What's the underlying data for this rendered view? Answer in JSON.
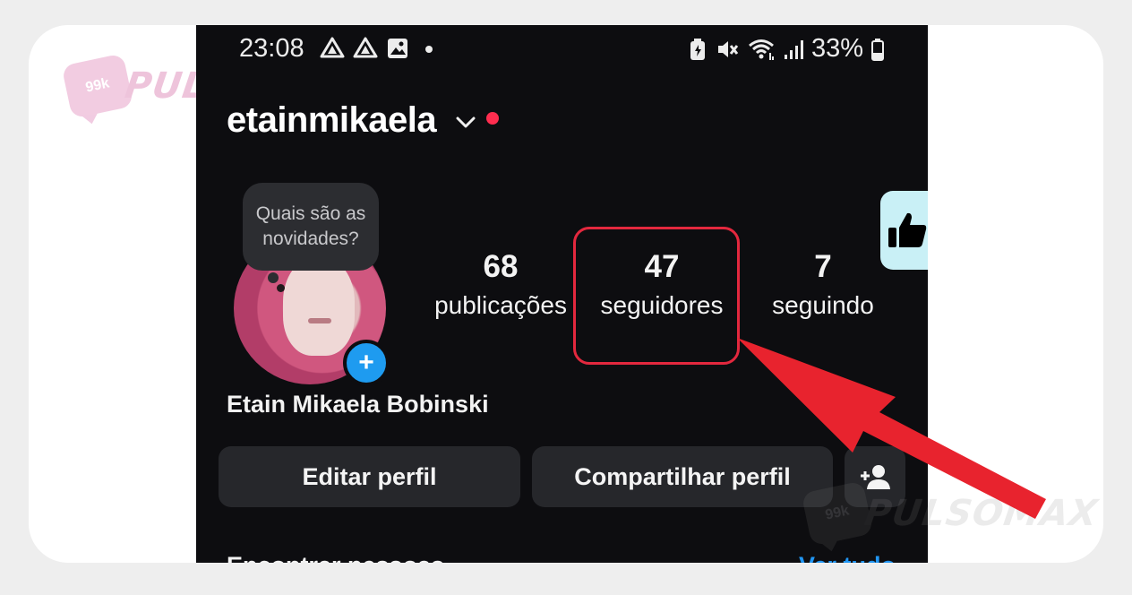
{
  "watermark": {
    "brand": "PULSOMAX",
    "badge": "99k"
  },
  "status_bar": {
    "time": "23:08",
    "left_icons": [
      "drive-icon",
      "drive-icon",
      "image-icon",
      "dot-icon"
    ],
    "right_icons": [
      "battery-saver-icon",
      "mute-icon",
      "wifi-icon",
      "signal-icon",
      "battery-icon"
    ],
    "battery": "33%"
  },
  "profile": {
    "username": "etainmikaela",
    "has_notification": true,
    "note_text": "Quais são as novidades?",
    "full_name": "Etain Mikaela Bobinski",
    "stats": [
      {
        "value": "68",
        "label": "publicações"
      },
      {
        "value": "47",
        "label": "seguidores"
      },
      {
        "value": "7",
        "label": "seguindo"
      }
    ]
  },
  "actions": {
    "edit_profile": "Editar perfil",
    "share_profile": "Compartilhar perfil",
    "add_person_icon": "add-person-icon"
  },
  "suggestions": {
    "title": "Encontrar pessoas",
    "see_all": "Ver tudo"
  },
  "annotation": {
    "highlight_color": "#e3283e",
    "arrow_color": "#e8232e",
    "highlighted": "seguidores"
  },
  "colors": {
    "background": "#0d0d10",
    "button": "#26272b",
    "accent_blue": "#1e9bf0",
    "notification_red": "#ff2d4f",
    "like_tab": "#c9f0f6"
  }
}
